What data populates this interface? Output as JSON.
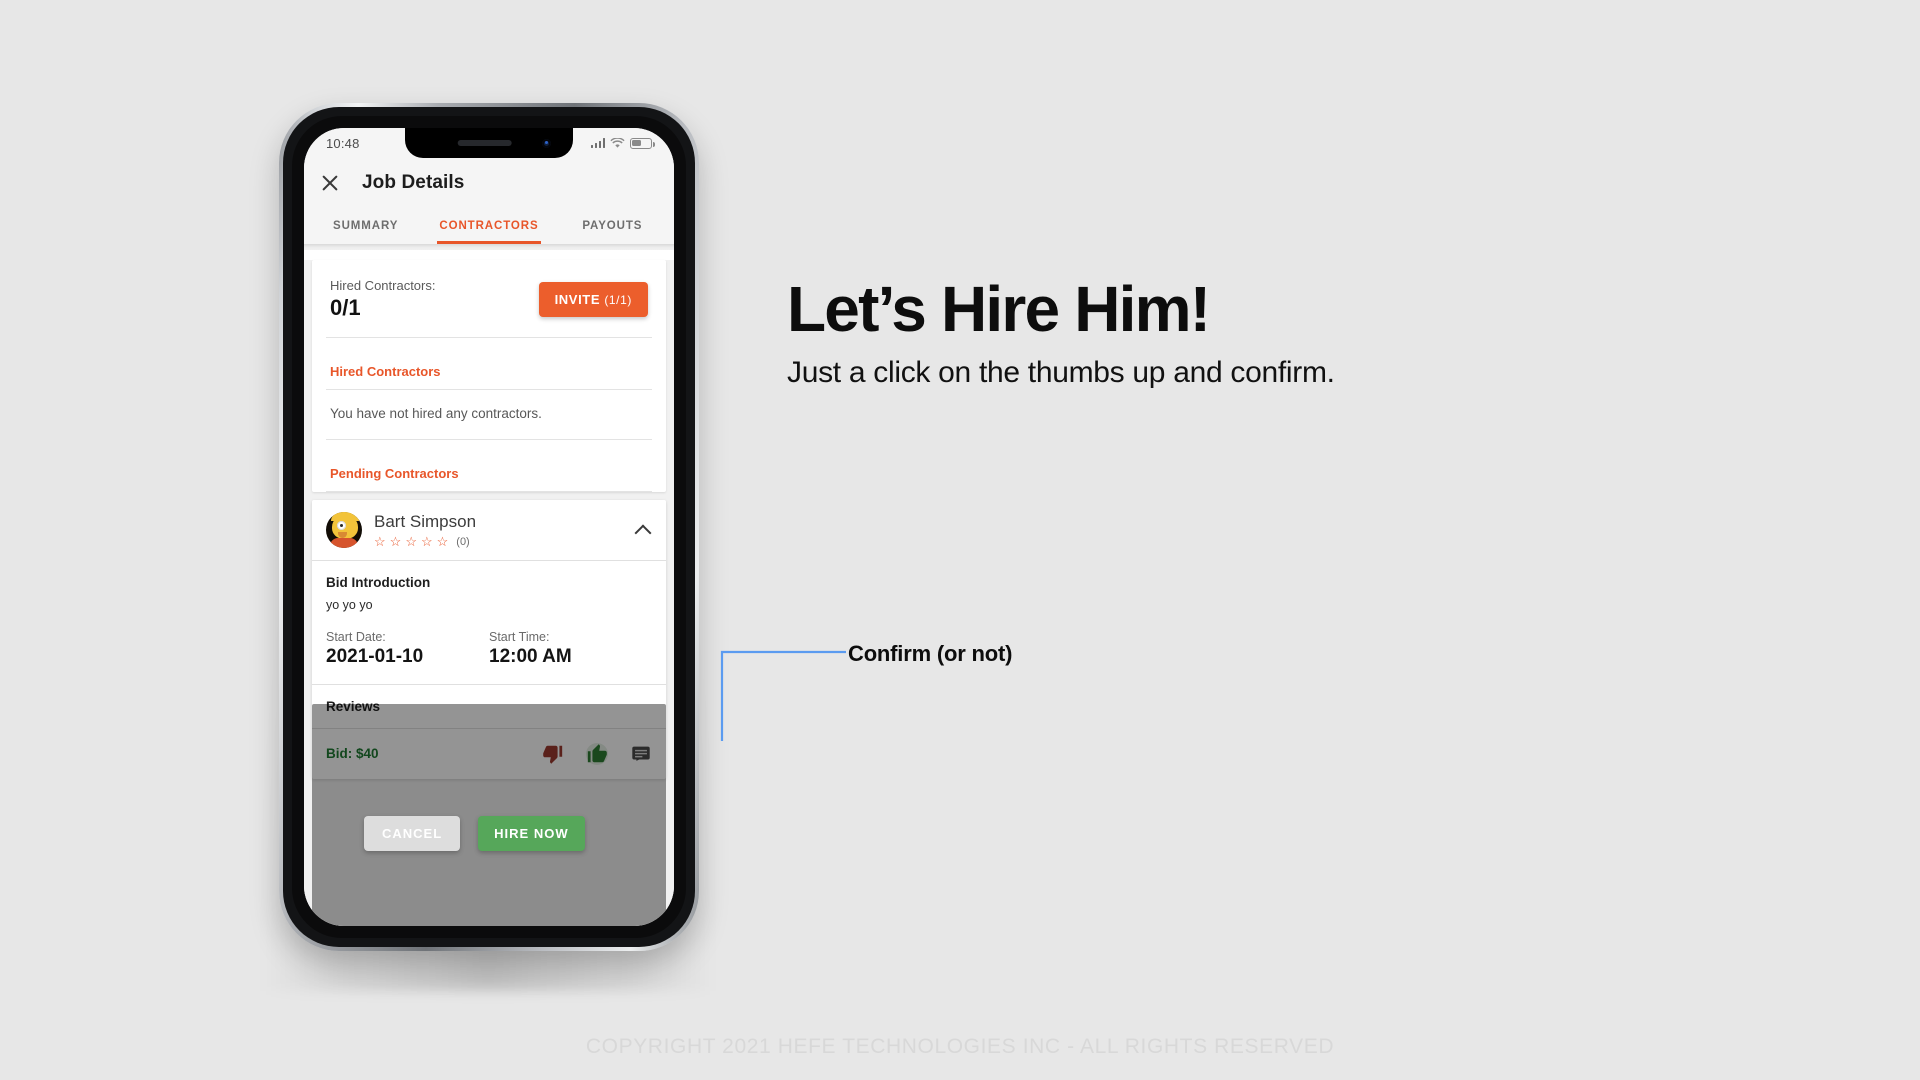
{
  "page": {
    "background_color": "#e7e7e7",
    "headline": "Let’s Hire Him!",
    "subhead": "Just a click on the thumbs up and confirm.",
    "callout": "Confirm (or not)",
    "footer": "COPYRIGHT 2021 HEFE TECHNOLOGIES INC - ALL RIGHTS RESERVED",
    "accent_color": "#e8562a",
    "green_color": "#56a75a",
    "leader_line_color": "#5b9bf0"
  },
  "phone": {
    "statusbar": {
      "time": "10:48",
      "signal_icon": "signal-bars-icon",
      "wifi_icon": "wifi-icon",
      "battery_icon": "battery-icon"
    },
    "appbar": {
      "close_icon": "close-icon",
      "title": "Job Details"
    },
    "tabs": [
      {
        "label": "SUMMARY",
        "active": false
      },
      {
        "label": "CONTRACTORS",
        "active": true
      },
      {
        "label": "PAYOUTS",
        "active": false
      }
    ],
    "summary_card": {
      "hired_label": "Hired Contractors:",
      "hired_count": "0/1",
      "invite_label": "INVITE",
      "invite_count": "(1/1)"
    },
    "sections": {
      "hired_title": "Hired Contractors",
      "hired_empty": "You have not hired any contractors.",
      "pending_title": "Pending Contractors"
    },
    "contractor": {
      "avatar_icon": "avatar",
      "name": "Bart Simpson",
      "stars": [
        "☆",
        "☆",
        "☆",
        "☆",
        "☆"
      ],
      "rating_count": "(0)",
      "collapse_icon": "chevron-up-icon",
      "bid_intro_title": "Bid Introduction",
      "bid_intro_text": "yo yo yo",
      "start_date_label": "Start Date:",
      "start_date_value": "2021-01-10",
      "start_time_label": "Start Time:",
      "start_time_value": "12:00 AM",
      "reviews_title": "Reviews",
      "bid_amount": "Bid: $40",
      "actions": [
        {
          "icon": "thumbs-down-icon",
          "color": "#9b3a2f"
        },
        {
          "icon": "thumbs-up-icon",
          "color": "#2e7d32"
        },
        {
          "icon": "message-icon",
          "color": "#4a4a4a"
        }
      ]
    },
    "dialog": {
      "cancel_label": "CANCEL",
      "hire_label": "HIRE NOW"
    }
  }
}
